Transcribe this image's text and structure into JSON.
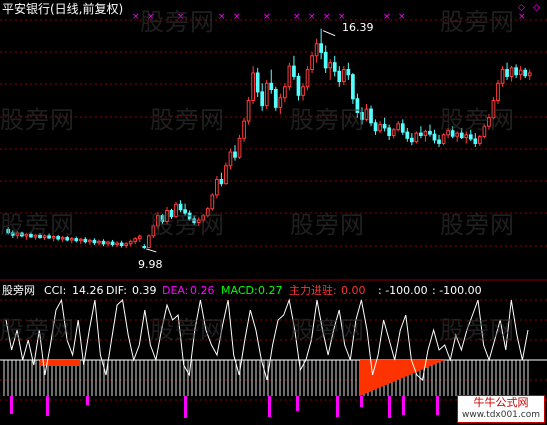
{
  "title": "平安银行(日线,前复权)",
  "watermark": "股旁网",
  "price_high_label": "16.39",
  "price_low_label": "9.98",
  "indicator": {
    "name": "股旁网",
    "cci_label": "CCI:",
    "cci": "14.26",
    "dif_label": "DIF:",
    "dif": "0.39",
    "dea_label": "DEA:",
    "dea": "0.26",
    "macd_label": "MACD:",
    "macd": "0.27",
    "main_label": "主力进驻:",
    "main": "0.00",
    "v1": ": -100.00",
    "v2": ": -100.00"
  },
  "logo": {
    "title": "牛牛公式网",
    "url": "www.tdx001.com"
  },
  "colors": {
    "up": "#ff3b3b",
    "down": "#54ffff",
    "grid": "#8b0000",
    "white": "#ffffff",
    "purple": "#ff00ff",
    "red_fill": "#ff3300",
    "yellow": "#ffff00"
  },
  "chart_data": {
    "type": "candlestick",
    "price_range": [
      9.98,
      16.39
    ],
    "candles": [
      [
        10.55,
        10.62,
        10.4,
        10.45
      ],
      [
        10.45,
        10.52,
        10.3,
        10.38
      ],
      [
        10.38,
        10.5,
        10.28,
        10.44
      ],
      [
        10.44,
        10.48,
        10.32,
        10.36
      ],
      [
        10.36,
        10.45,
        10.25,
        10.4
      ],
      [
        10.4,
        10.46,
        10.3,
        10.33
      ],
      [
        10.33,
        10.41,
        10.25,
        10.38
      ],
      [
        10.38,
        10.44,
        10.28,
        10.31
      ],
      [
        10.31,
        10.4,
        10.24,
        10.36
      ],
      [
        10.36,
        10.43,
        10.27,
        10.3
      ],
      [
        10.3,
        10.38,
        10.2,
        10.34
      ],
      [
        10.34,
        10.39,
        10.22,
        10.27
      ],
      [
        10.27,
        10.36,
        10.18,
        10.31
      ],
      [
        10.31,
        10.36,
        10.2,
        10.24
      ],
      [
        10.24,
        10.33,
        10.15,
        10.28
      ],
      [
        10.28,
        10.34,
        10.17,
        10.22
      ],
      [
        10.22,
        10.3,
        10.12,
        10.26
      ],
      [
        10.26,
        10.32,
        10.14,
        10.19
      ],
      [
        10.19,
        10.28,
        10.1,
        10.23
      ],
      [
        10.23,
        10.29,
        10.1,
        10.16
      ],
      [
        10.16,
        10.25,
        10.08,
        10.2
      ],
      [
        10.2,
        10.26,
        10.06,
        10.13
      ],
      [
        10.13,
        10.22,
        10.05,
        10.18
      ],
      [
        10.18,
        10.24,
        10.05,
        10.11
      ],
      [
        10.11,
        10.2,
        10.03,
        10.15
      ],
      [
        10.15,
        10.22,
        10.02,
        10.08
      ],
      [
        10.08,
        10.18,
        10.0,
        10.13
      ],
      [
        10.13,
        10.25,
        10.05,
        10.2
      ],
      [
        10.2,
        10.32,
        10.12,
        10.28
      ],
      [
        10.28,
        10.4,
        10.18,
        10.35
      ],
      [
        10.05,
        10.12,
        9.98,
        10.02
      ],
      [
        10.02,
        10.4,
        10.0,
        10.36
      ],
      [
        10.36,
        10.7,
        10.3,
        10.65
      ],
      [
        10.65,
        11.05,
        10.55,
        10.95
      ],
      [
        10.95,
        11.0,
        10.7,
        10.78
      ],
      [
        10.78,
        11.2,
        10.7,
        11.1
      ],
      [
        11.1,
        11.15,
        10.85,
        10.92
      ],
      [
        10.92,
        11.35,
        10.88,
        11.28
      ],
      [
        11.28,
        11.4,
        11.05,
        11.12
      ],
      [
        11.12,
        11.3,
        10.95,
        11.02
      ],
      [
        11.02,
        11.1,
        10.8,
        10.85
      ],
      [
        10.85,
        10.95,
        10.68,
        10.75
      ],
      [
        10.75,
        10.9,
        10.65,
        10.82
      ],
      [
        10.82,
        11.0,
        10.75,
        10.95
      ],
      [
        10.95,
        11.2,
        10.9,
        11.15
      ],
      [
        11.15,
        11.6,
        11.1,
        11.55
      ],
      [
        11.55,
        12.1,
        11.45,
        12.0
      ],
      [
        12.0,
        12.2,
        11.8,
        11.88
      ],
      [
        11.88,
        12.5,
        11.85,
        12.4
      ],
      [
        12.4,
        12.9,
        12.3,
        12.8
      ],
      [
        12.8,
        13.0,
        12.55,
        12.65
      ],
      [
        12.65,
        13.3,
        12.6,
        13.2
      ],
      [
        13.2,
        13.8,
        13.1,
        13.7
      ],
      [
        13.7,
        14.4,
        13.6,
        14.3
      ],
      [
        14.3,
        15.3,
        14.2,
        15.1
      ],
      [
        15.1,
        15.25,
        14.4,
        14.55
      ],
      [
        14.55,
        14.8,
        14.0,
        14.15
      ],
      [
        14.15,
        14.9,
        14.05,
        14.8
      ],
      [
        14.8,
        15.2,
        14.5,
        14.62
      ],
      [
        14.62,
        14.7,
        14.0,
        14.1
      ],
      [
        14.1,
        14.5,
        13.9,
        14.38
      ],
      [
        14.38,
        14.8,
        14.25,
        14.7
      ],
      [
        14.7,
        15.4,
        14.6,
        15.3
      ],
      [
        15.3,
        15.6,
        14.9,
        15.0
      ],
      [
        15.0,
        15.1,
        14.3,
        14.45
      ],
      [
        14.45,
        14.8,
        14.3,
        14.7
      ],
      [
        14.7,
        15.3,
        14.6,
        15.2
      ],
      [
        15.2,
        15.7,
        15.1,
        15.6
      ],
      [
        15.6,
        16.1,
        15.4,
        15.95
      ],
      [
        15.95,
        16.39,
        15.5,
        15.7
      ],
      [
        15.7,
        15.9,
        15.1,
        15.25
      ],
      [
        15.25,
        15.5,
        14.9,
        15.4
      ],
      [
        15.4,
        15.6,
        15.0,
        15.15
      ],
      [
        15.15,
        15.3,
        14.7,
        14.85
      ],
      [
        14.85,
        15.3,
        14.75,
        15.2
      ],
      [
        15.2,
        15.4,
        14.9,
        15.05
      ],
      [
        15.05,
        15.1,
        14.2,
        14.35
      ],
      [
        14.35,
        14.5,
        13.8,
        13.95
      ],
      [
        13.95,
        14.1,
        13.6,
        13.75
      ],
      [
        13.75,
        14.2,
        13.7,
        14.05
      ],
      [
        14.05,
        14.15,
        13.55,
        13.65
      ],
      [
        13.65,
        13.75,
        13.3,
        13.42
      ],
      [
        13.42,
        13.7,
        13.35,
        13.6
      ],
      [
        13.6,
        13.8,
        13.4,
        13.5
      ],
      [
        13.5,
        13.6,
        13.15,
        13.28
      ],
      [
        13.28,
        13.5,
        13.2,
        13.45
      ],
      [
        13.45,
        13.7,
        13.4,
        13.62
      ],
      [
        13.62,
        13.75,
        13.3,
        13.38
      ],
      [
        13.38,
        13.5,
        13.1,
        13.2
      ],
      [
        13.2,
        13.35,
        13.0,
        13.1
      ],
      [
        13.1,
        13.4,
        13.05,
        13.35
      ],
      [
        13.35,
        13.55,
        13.2,
        13.28
      ],
      [
        13.28,
        13.45,
        13.1,
        13.4
      ],
      [
        13.4,
        13.6,
        13.25,
        13.32
      ],
      [
        13.32,
        13.45,
        13.05,
        13.15
      ],
      [
        13.15,
        13.3,
        12.95,
        13.05
      ],
      [
        13.05,
        13.35,
        13.0,
        13.3
      ],
      [
        13.3,
        13.5,
        13.2,
        13.42
      ],
      [
        13.42,
        13.55,
        13.2,
        13.26
      ],
      [
        13.26,
        13.4,
        13.1,
        13.35
      ],
      [
        13.35,
        13.5,
        13.18,
        13.22
      ],
      [
        13.22,
        13.4,
        13.05,
        13.3
      ],
      [
        13.3,
        13.45,
        13.12,
        13.18
      ],
      [
        13.18,
        13.35,
        12.95,
        13.05
      ],
      [
        13.05,
        13.3,
        12.98,
        13.25
      ],
      [
        13.25,
        13.6,
        13.2,
        13.55
      ],
      [
        13.55,
        13.9,
        13.45,
        13.8
      ],
      [
        13.8,
        14.4,
        13.75,
        14.3
      ],
      [
        14.3,
        14.9,
        14.2,
        14.8
      ],
      [
        14.8,
        15.3,
        14.7,
        15.2
      ],
      [
        15.2,
        15.4,
        14.9,
        15.0
      ],
      [
        15.0,
        15.3,
        14.85,
        15.25
      ],
      [
        15.25,
        15.35,
        14.95,
        15.05
      ],
      [
        15.05,
        15.3,
        14.9,
        15.18
      ],
      [
        15.18,
        15.25,
        14.95,
        15.02
      ],
      [
        15.02,
        15.2,
        14.9,
        15.1
      ]
    ]
  }
}
